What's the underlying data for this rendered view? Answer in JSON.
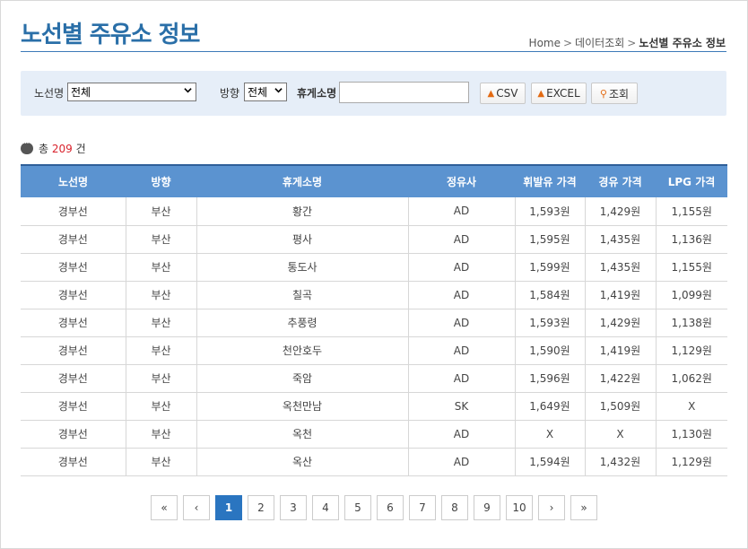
{
  "header": {
    "title": "노선별 주유소 정보",
    "breadcrumb": [
      "Home",
      "데이터조회",
      "노선별 주유소 정보"
    ]
  },
  "search": {
    "route_label": "노선명",
    "route_value": "전체",
    "direction_label": "방향",
    "direction_value": "전체",
    "rest_area_label": "휴게소명",
    "rest_area_value": "",
    "csv_label": "CSV",
    "excel_label": "EXCEL",
    "search_label": "조회"
  },
  "summary": {
    "prefix": "총",
    "count": "209",
    "suffix": "건"
  },
  "table": {
    "columns": [
      "노선명",
      "방향",
      "휴게소명",
      "정유사",
      "휘발유 가격",
      "경유 가격",
      "LPG 가격"
    ],
    "rows": [
      [
        "경부선",
        "부산",
        "황간",
        "AD",
        "1,593원",
        "1,429원",
        "1,155원"
      ],
      [
        "경부선",
        "부산",
        "평사",
        "AD",
        "1,595원",
        "1,435원",
        "1,136원"
      ],
      [
        "경부선",
        "부산",
        "통도사",
        "AD",
        "1,599원",
        "1,435원",
        "1,155원"
      ],
      [
        "경부선",
        "부산",
        "칠곡",
        "AD",
        "1,584원",
        "1,419원",
        "1,099원"
      ],
      [
        "경부선",
        "부산",
        "추풍령",
        "AD",
        "1,593원",
        "1,429원",
        "1,138원"
      ],
      [
        "경부선",
        "부산",
        "천안호두",
        "AD",
        "1,590원",
        "1,419원",
        "1,129원"
      ],
      [
        "경부선",
        "부산",
        "죽암",
        "AD",
        "1,596원",
        "1,422원",
        "1,062원"
      ],
      [
        "경부선",
        "부산",
        "옥천만남",
        "SK",
        "1,649원",
        "1,509원",
        "X"
      ],
      [
        "경부선",
        "부산",
        "옥천",
        "AD",
        "X",
        "X",
        "1,130원"
      ],
      [
        "경부선",
        "부산",
        "옥산",
        "AD",
        "1,594원",
        "1,432원",
        "1,129원"
      ]
    ]
  },
  "pagination": {
    "first": "«",
    "prev": "‹",
    "pages": [
      "1",
      "2",
      "3",
      "4",
      "5",
      "6",
      "7",
      "8",
      "9",
      "10"
    ],
    "current": "1",
    "next": "›",
    "last": "»"
  }
}
